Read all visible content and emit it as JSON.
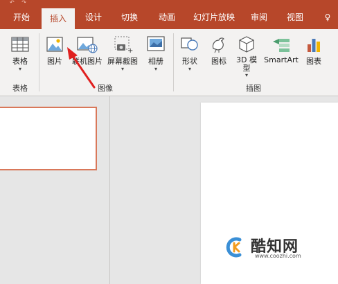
{
  "tabs": [
    {
      "label": "开始",
      "active": false
    },
    {
      "label": "插入",
      "active": true
    },
    {
      "label": "设计",
      "active": false
    },
    {
      "label": "切换",
      "active": false
    },
    {
      "label": "动画",
      "active": false
    },
    {
      "label": "幻灯片放映",
      "active": false
    },
    {
      "label": "审阅",
      "active": false
    },
    {
      "label": "视图",
      "active": false
    },
    {
      "label": "♀",
      "active": false
    }
  ],
  "ribbon": {
    "table_group": {
      "button": "表格",
      "label": "表格"
    },
    "images_group": {
      "picture": "图片",
      "online_picture": "联机图片",
      "screenshot": "屏幕截图",
      "album": "相册",
      "label": "图像"
    },
    "illustrations_group": {
      "shapes": "形状",
      "icons": "图标",
      "model3d": "3D 模型",
      "model3d_line1": "3D 模",
      "model3d_line2": "型",
      "smartart": "SmartArt",
      "chart": "图表",
      "label": "插图"
    }
  },
  "watermark": {
    "name": "酷知网",
    "url": "www.coozhi.com"
  },
  "colors": {
    "accent": "#b7472a",
    "thumb_border": "#d9785a",
    "arrow": "#e0201f"
  }
}
